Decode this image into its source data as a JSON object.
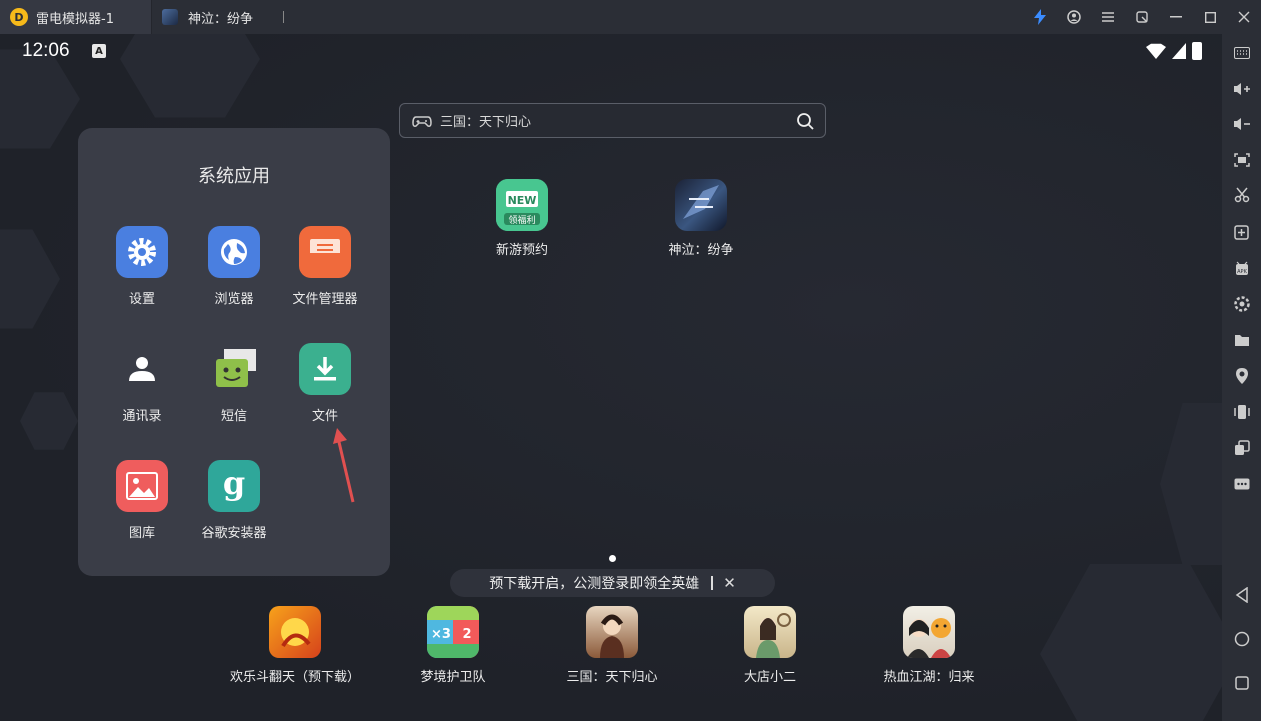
{
  "titlebar": {
    "tab_main": "雷电模拟器-1",
    "tab_game": "神泣：纷争",
    "logo_char": "D",
    "actions": [
      "bolt-icon",
      "account-icon",
      "menu-icon",
      "restore-mini-icon",
      "minimize-icon",
      "maximize-icon",
      "close-icon"
    ]
  },
  "statusbar": {
    "time": "12:06",
    "keyboard_badge": "A"
  },
  "search": {
    "placeholder": "三国：天下归心"
  },
  "folder": {
    "title": "系统应用",
    "apps": [
      {
        "label": "设置",
        "icon": "settings-icon",
        "color": "#4a7fe0"
      },
      {
        "label": "浏览器",
        "icon": "browser-icon",
        "color": "#4a7fe0"
      },
      {
        "label": "文件管理器",
        "icon": "file-manager-icon",
        "color": "#f06a3c"
      },
      {
        "label": "通讯录",
        "icon": "contacts-icon",
        "color": "#3a3d47"
      },
      {
        "label": "短信",
        "icon": "sms-icon",
        "color": "#8fc04a"
      },
      {
        "label": "文件",
        "icon": "download-icon",
        "color": "#3bb08f"
      },
      {
        "label": "图库",
        "icon": "gallery-icon",
        "color": "#ef5d5d"
      },
      {
        "label": "谷歌安装器",
        "icon": "google-installer-icon",
        "color": "#2fa79a"
      }
    ]
  },
  "desktop": [
    {
      "label": "新游预约",
      "badge_top": "NEW",
      "badge_bottom": "领福利"
    },
    {
      "label": "神泣：纷争"
    }
  ],
  "toast": {
    "text": "预下载开启，公测登录即领全英雄"
  },
  "dock": [
    {
      "label": "欢乐斗翻天（预下载）"
    },
    {
      "label": "梦境护卫队"
    },
    {
      "label": "三国：天下归心"
    },
    {
      "label": "大店小二"
    },
    {
      "label": "热血江湖：归来"
    }
  ],
  "sidebar": [
    "keyboard-icon",
    "volume-up-icon",
    "volume-down-icon",
    "screenshot-icon",
    "scissors-icon",
    "add-window-icon",
    "apk-icon",
    "settings-gear-icon",
    "folder-icon",
    "location-icon",
    "shake-icon",
    "multi-window-icon",
    "more-icon",
    "back-icon",
    "home-icon",
    "recents-icon"
  ]
}
